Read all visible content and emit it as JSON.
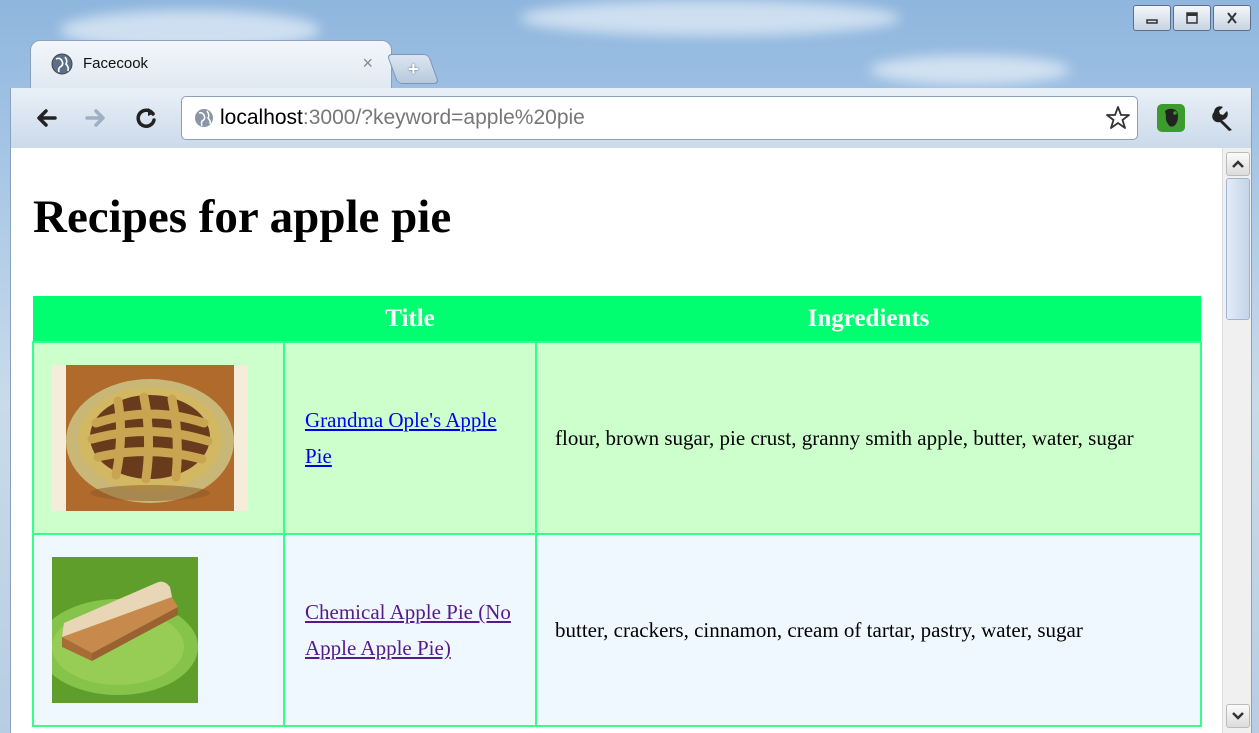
{
  "browser": {
    "tab_title": "Facecook",
    "url_host": "localhost",
    "url_rest": ":3000/?keyword=apple%20pie",
    "tab_close": "×",
    "new_tab": "+"
  },
  "page": {
    "title": "Recipes for apple pie",
    "table": {
      "headers": [
        "",
        "Title",
        "Ingredients"
      ],
      "rows": [
        {
          "title": "Grandma Ople's Apple Pie",
          "ingredients": "flour, brown sugar, pie crust, granny smith apple, butter, water, sugar"
        },
        {
          "title": "Chemical Apple Pie (No Apple Apple Pie)",
          "ingredients": "butter, crackers, cinnamon, cream of tartar, pastry, water, sugar"
        }
      ]
    }
  },
  "colors": {
    "header_bg": "#00ff70",
    "row_even_bg": "#ccffcc",
    "row_odd_bg": "#f0f8ff",
    "link": "#0000ee",
    "visited_link": "#551a8b"
  },
  "icons": [
    "globe-icon",
    "close-icon",
    "back-icon",
    "forward-icon",
    "reload-icon",
    "star-icon",
    "evernote-icon",
    "wrench-icon",
    "minimize-icon",
    "maximize-icon",
    "window-close-icon"
  ]
}
